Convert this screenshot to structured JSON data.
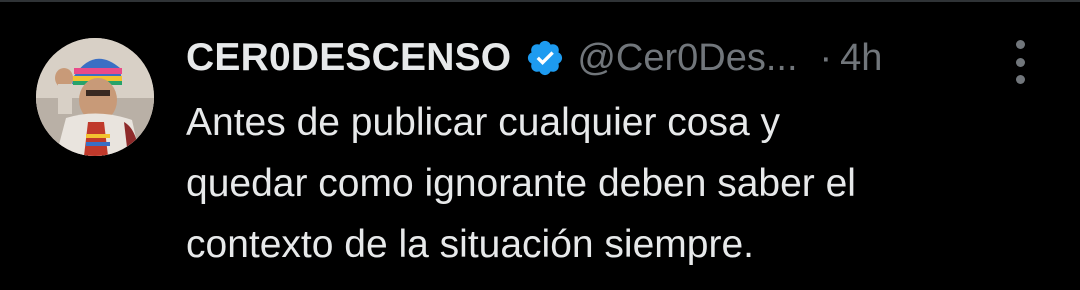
{
  "tweet": {
    "display_name": "CER0DESCENSO",
    "handle": "@Cer0Des...",
    "separator": "·",
    "time": "4h",
    "verified": true,
    "text_lines": [
      "Antes de publicar cualquier cosa y",
      "quedar como ignorante deben saber el",
      "contexto de la situación siempre."
    ]
  },
  "icons": {
    "verified": "verified-badge-icon",
    "more": "more-vertical-icon",
    "avatar": "profile-avatar"
  },
  "colors": {
    "background": "#000000",
    "primary_text": "#e7e9ea",
    "secondary_text": "#71767b",
    "verified_blue": "#1d9bf0",
    "divider": "#2f3336"
  }
}
